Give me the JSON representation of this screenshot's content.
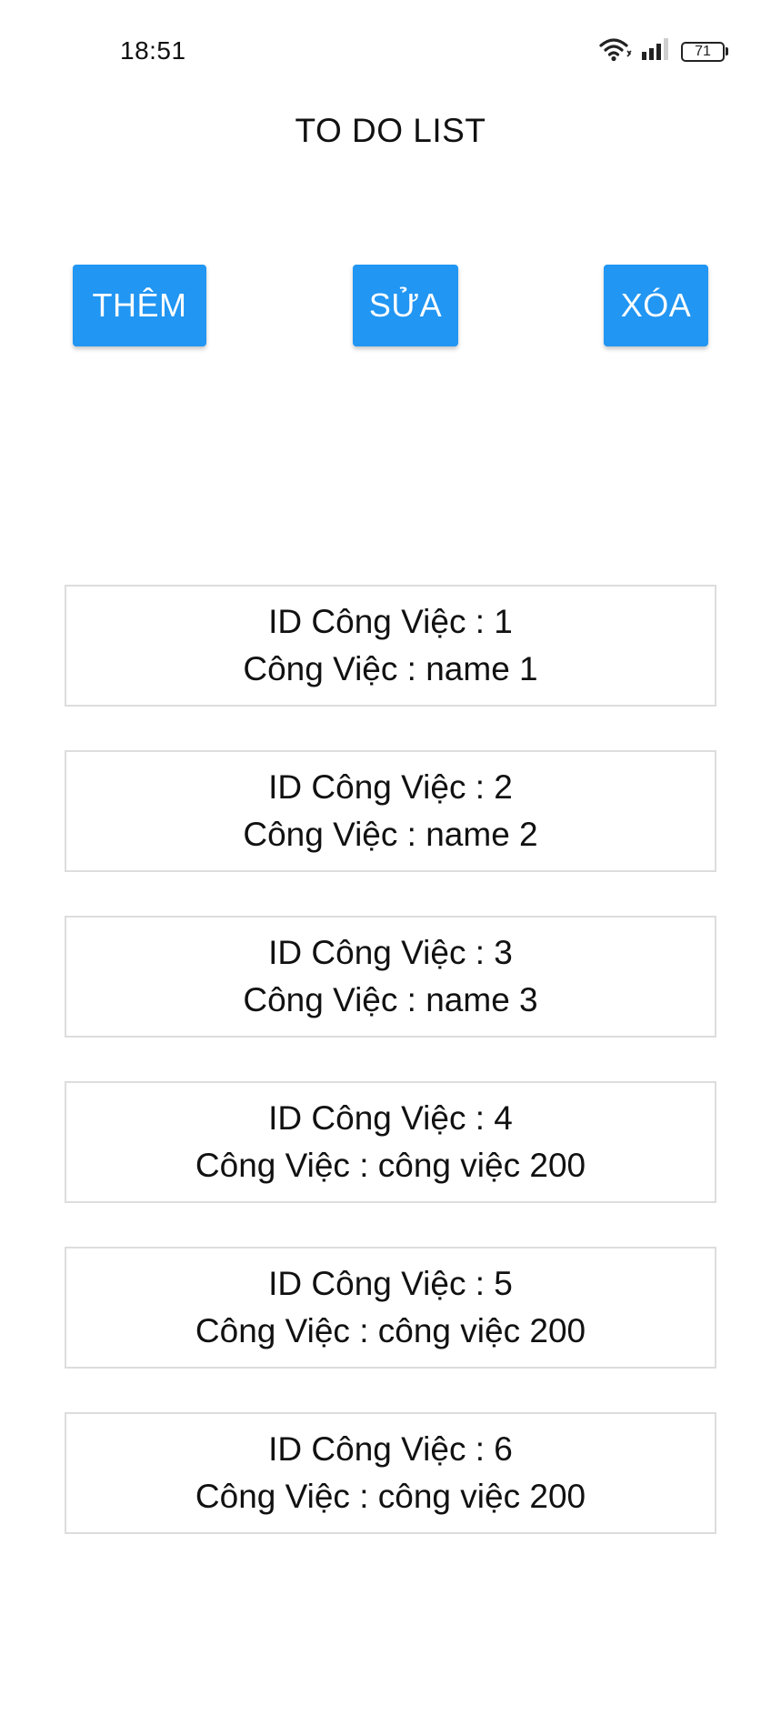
{
  "status_bar": {
    "time": "18:51",
    "battery_level": "71"
  },
  "header": {
    "title": "TO DO LIST"
  },
  "toolbar": {
    "add_label": "THÊM",
    "edit_label": "SỬA",
    "delete_label": "XÓA",
    "accent_color": "#2196f3"
  },
  "tasks": [
    {
      "id_line": "ID Công Việc : 1",
      "name_line": "Công Việc : name 1"
    },
    {
      "id_line": "ID Công Việc : 2",
      "name_line": "Công Việc : name 2"
    },
    {
      "id_line": "ID Công Việc : 3",
      "name_line": "Công Việc : name 3"
    },
    {
      "id_line": "ID Công Việc : 4",
      "name_line": "Công Việc : công việc 200"
    },
    {
      "id_line": "ID Công Việc : 5",
      "name_line": "Công Việc : công việc 200"
    },
    {
      "id_line": "ID Công Việc : 6",
      "name_line": "Công Việc : công việc 200"
    }
  ]
}
